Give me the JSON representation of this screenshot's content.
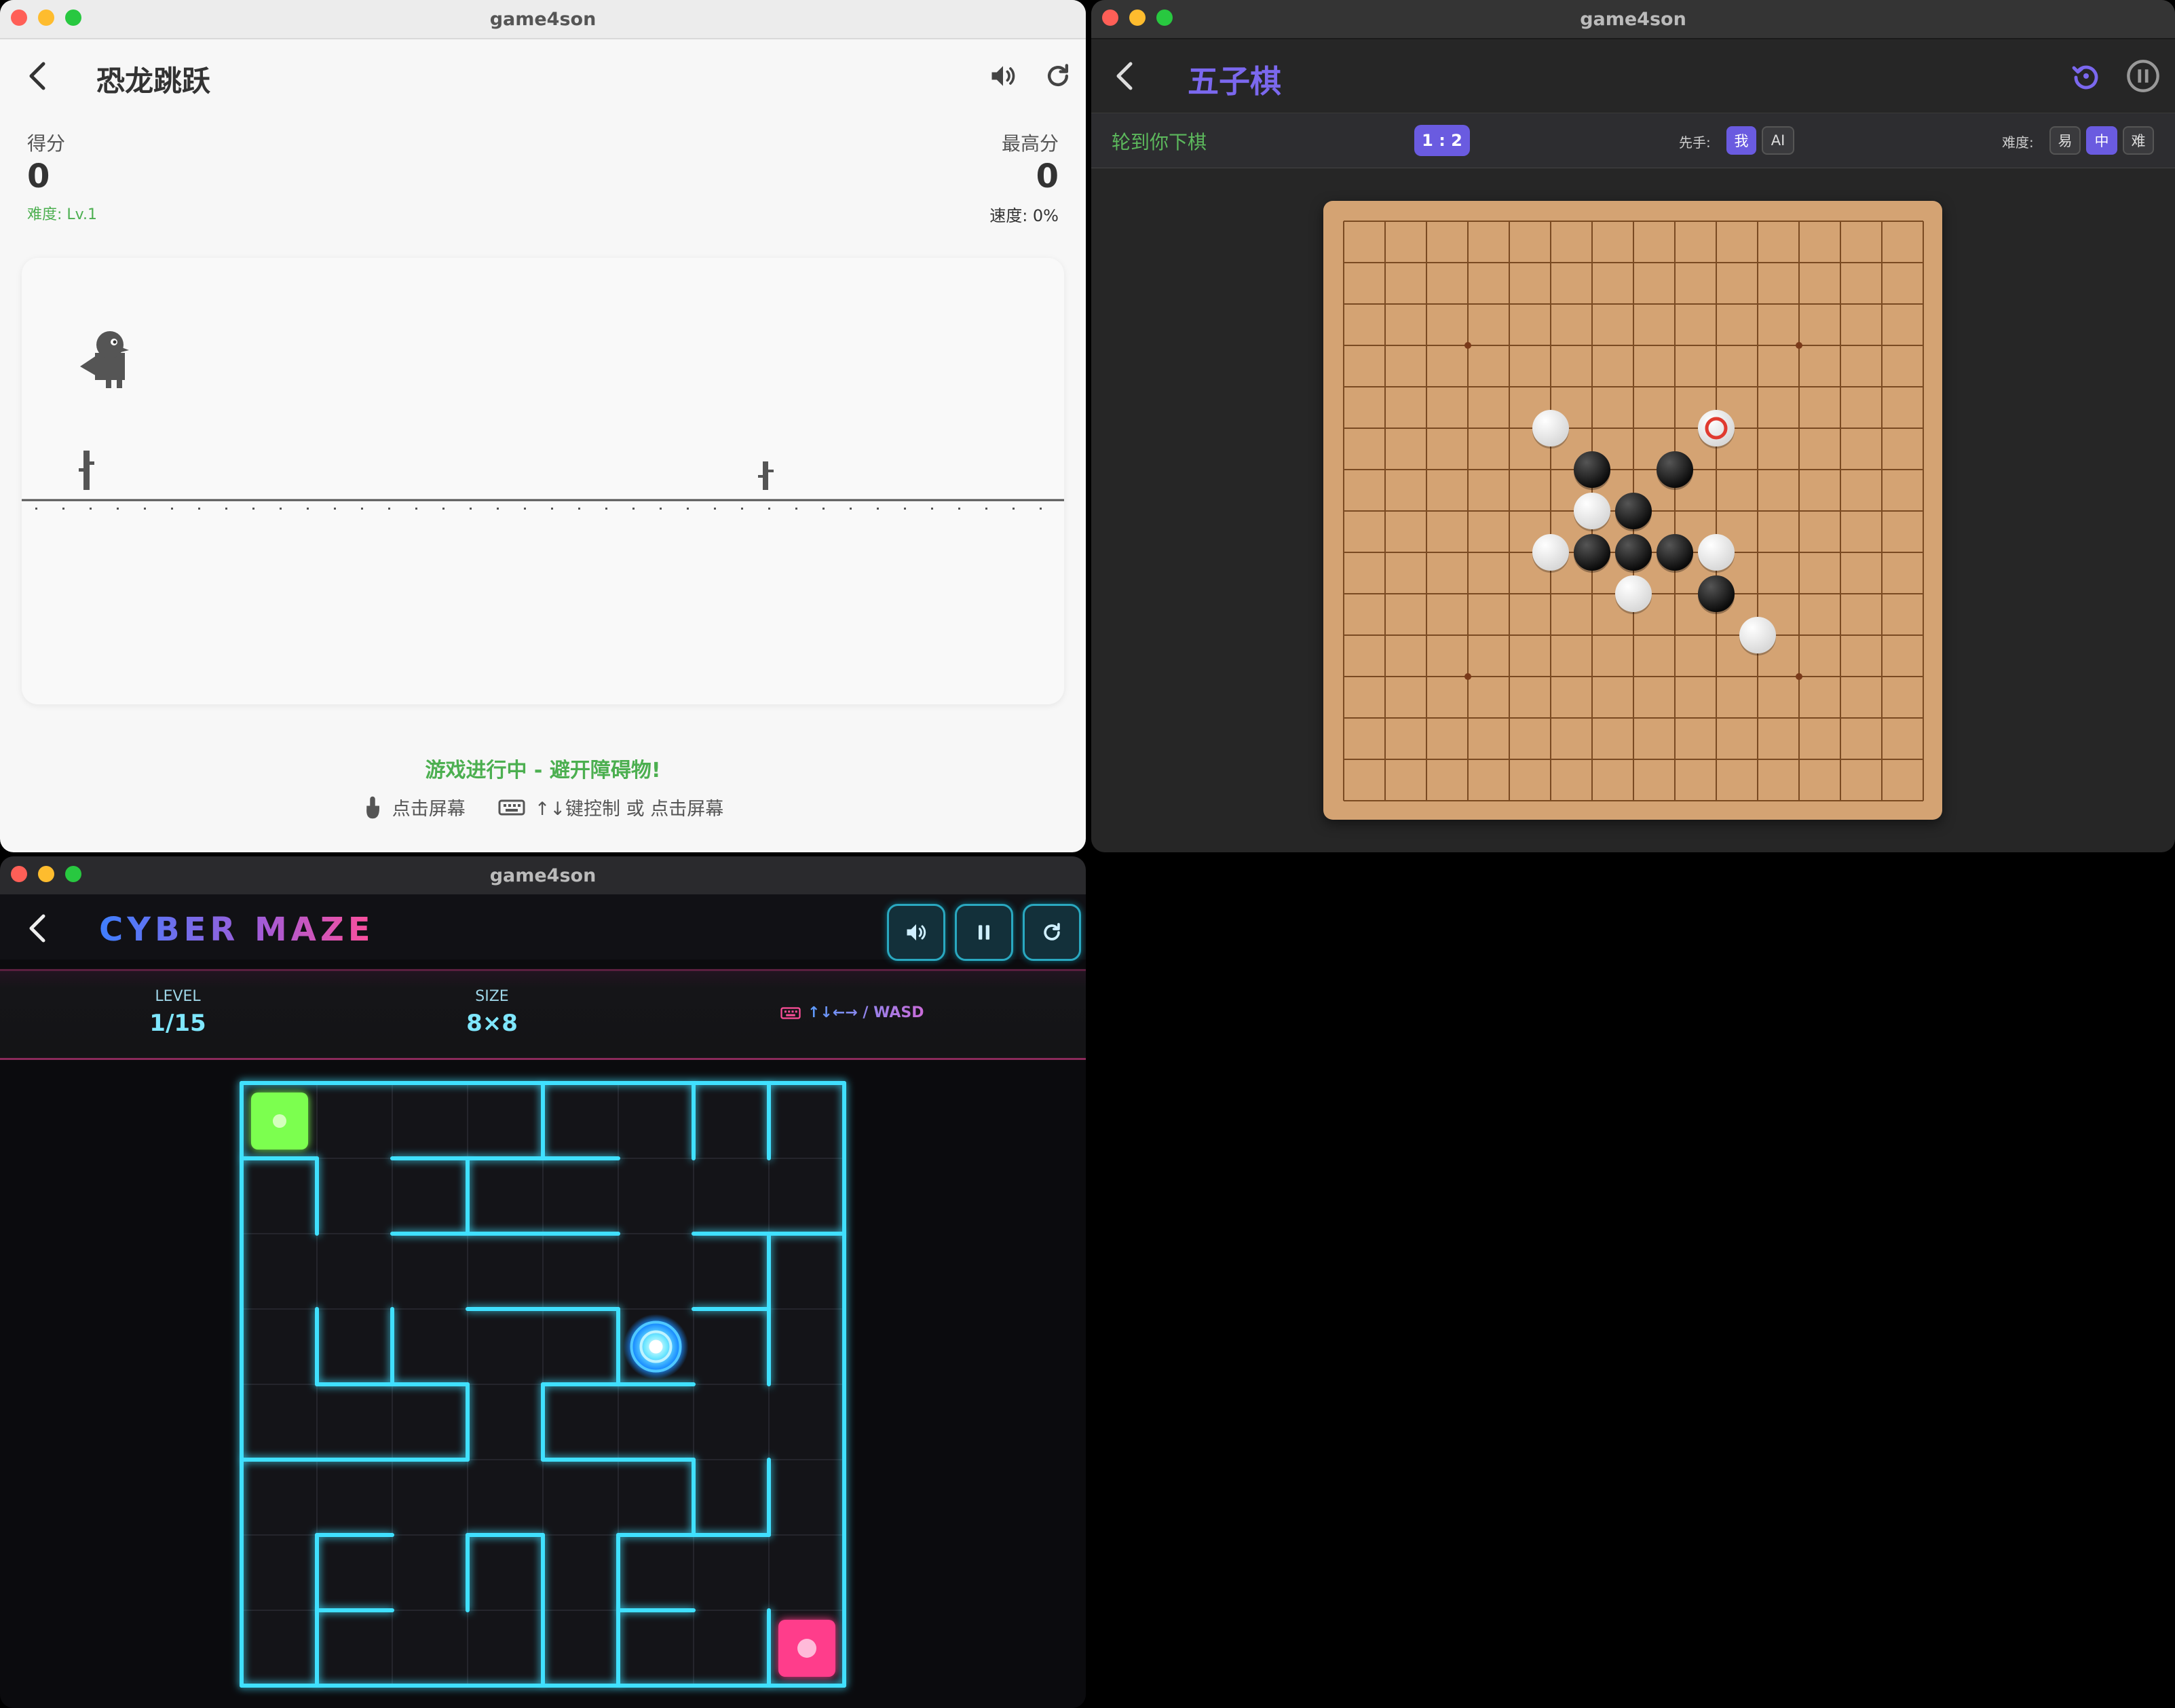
{
  "dino": {
    "window_title": "game4son",
    "title": "恐龙跳跃",
    "score_label": "得分",
    "score": "0",
    "high_label": "最高分",
    "high": "0",
    "difficulty": "难度: Lv.1",
    "speed": "速度: 0%",
    "status": "游戏进行中 - 避开障碍物!",
    "hint_tap": "点击屏幕",
    "hint_keys": "↑↓键控制 或 点击屏幕",
    "colors": {
      "accent_green": "#4caf50",
      "ink": "#555555"
    }
  },
  "gomoku": {
    "window_title": "game4son",
    "title": "五子棋",
    "turn": "轮到你下棋",
    "score": "1 : 2",
    "first_label": "先手:",
    "first_options": [
      "我",
      "AI"
    ],
    "first_selected": "我",
    "difficulty_label": "难度:",
    "difficulty_options": [
      "易",
      "中",
      "难"
    ],
    "difficulty_selected": "中",
    "board_lines": 15,
    "stones": [
      {
        "color": "white",
        "col": 5,
        "row": 5
      },
      {
        "color": "white",
        "col": 9,
        "row": 5,
        "last": true
      },
      {
        "color": "black",
        "col": 6,
        "row": 6
      },
      {
        "color": "black",
        "col": 8,
        "row": 6
      },
      {
        "color": "white",
        "col": 6,
        "row": 7
      },
      {
        "color": "black",
        "col": 7,
        "row": 7
      },
      {
        "color": "white",
        "col": 5,
        "row": 8
      },
      {
        "color": "black",
        "col": 6,
        "row": 8
      },
      {
        "color": "black",
        "col": 7,
        "row": 8
      },
      {
        "color": "black",
        "col": 8,
        "row": 8
      },
      {
        "color": "white",
        "col": 9,
        "row": 8
      },
      {
        "color": "white",
        "col": 7,
        "row": 9
      },
      {
        "color": "black",
        "col": 9,
        "row": 9
      },
      {
        "color": "white",
        "col": 10,
        "row": 10
      }
    ],
    "star_points": [
      [
        3,
        3
      ],
      [
        11,
        3
      ],
      [
        3,
        11
      ],
      [
        11,
        11
      ]
    ],
    "colors": {
      "accent": "#7b68ee",
      "green": "#5cb85c",
      "board": "#d4a373"
    }
  },
  "maze": {
    "window_title": "game4son",
    "title": "CYBER MAZE",
    "level_label": "LEVEL",
    "level": "1/15",
    "size_label": "SIZE",
    "size": "8×8",
    "controls": "↑↓←→ / WASD",
    "grid_size": 8,
    "start_cell": [
      0,
      0
    ],
    "goal_cell": [
      7,
      7
    ],
    "player_cell": [
      5,
      3
    ],
    "colors": {
      "wall": "#3fe0ff",
      "start": "#7cff4f",
      "goal": "#ff3d8b",
      "title_from": "#3f7fff",
      "title_to": "#ff4f9a"
    }
  }
}
